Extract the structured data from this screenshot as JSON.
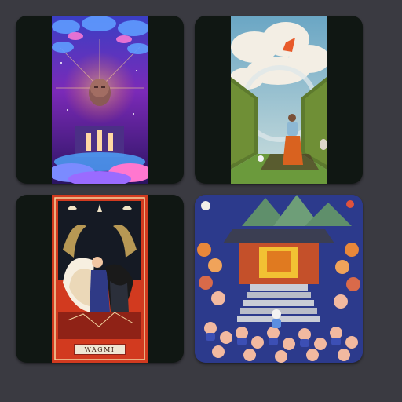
{
  "gallery": {
    "tiles": [
      {
        "name": "cosmic-meditation-figure"
      },
      {
        "name": "hedge-maze-cloud-portal"
      },
      {
        "name": "tarot-angel-card",
        "caption": "WAGMI"
      },
      {
        "name": "crowded-temple-stairs"
      }
    ]
  },
  "colors": {
    "page_background": "#3a3a41",
    "tile_background": "#101713"
  }
}
